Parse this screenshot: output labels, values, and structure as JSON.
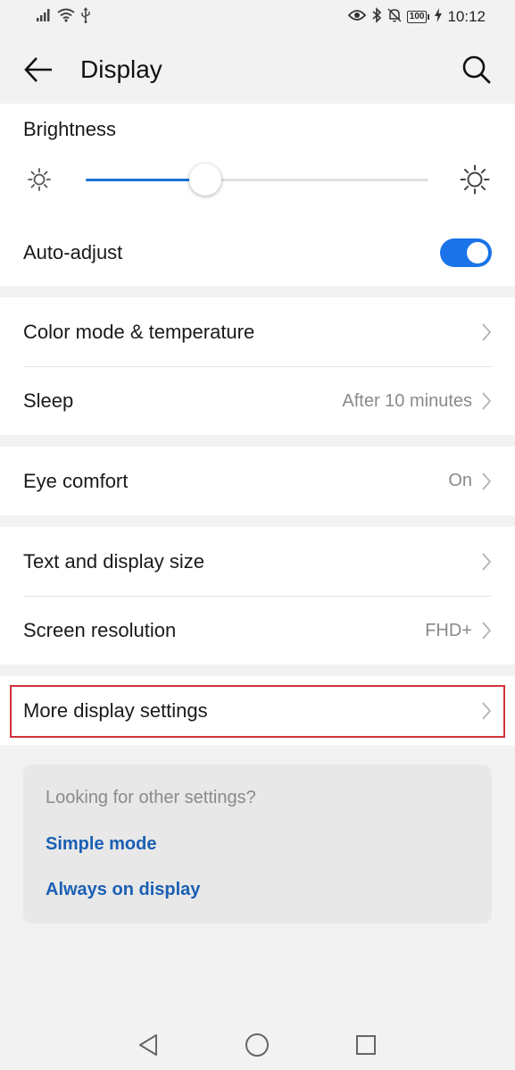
{
  "status_bar": {
    "battery": "100",
    "time": "10:12"
  },
  "toolbar": {
    "title": "Display"
  },
  "brightness": {
    "label": "Brightness",
    "level": 0.35
  },
  "auto_adjust": {
    "label": "Auto-adjust",
    "on": true
  },
  "group1": {
    "color_mode": {
      "label": "Color mode & temperature"
    },
    "sleep": {
      "label": "Sleep",
      "value": "After 10 minutes"
    }
  },
  "group2": {
    "eye_comfort": {
      "label": "Eye comfort",
      "value": "On"
    }
  },
  "group3": {
    "text_size": {
      "label": "Text and display size"
    },
    "resolution": {
      "label": "Screen resolution",
      "value": "FHD+"
    }
  },
  "group4": {
    "more_display": {
      "label": "More display settings"
    }
  },
  "suggestions": {
    "question": "Looking for other settings?",
    "links": [
      "Simple mode",
      "Always on display"
    ]
  },
  "colors": {
    "accent": "#1a73e8",
    "link": "#1a5fb4",
    "highlight": "#d0313a"
  }
}
